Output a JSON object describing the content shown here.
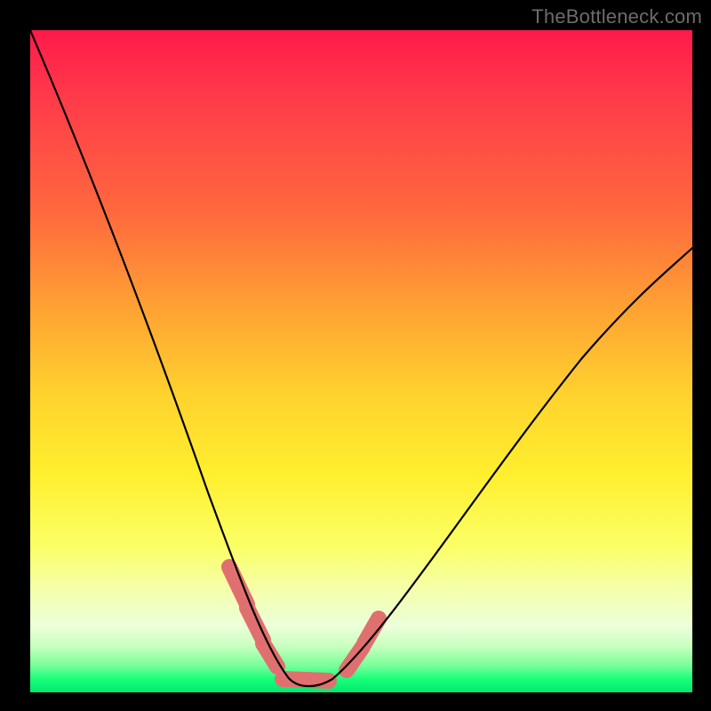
{
  "attribution": "TheBottleneck.com",
  "chart_data": {
    "type": "line",
    "title": "",
    "xlabel": "",
    "ylabel": "",
    "xlim": [
      0,
      100
    ],
    "ylim": [
      0,
      100
    ],
    "series": [
      {
        "name": "bottleneck-curve",
        "x": [
          0,
          5,
          10,
          15,
          20,
          25,
          30,
          33,
          36,
          38,
          40,
          42,
          45,
          50,
          55,
          60,
          65,
          70,
          75,
          80,
          85,
          90,
          95,
          100
        ],
        "y": [
          100,
          89,
          78,
          67,
          56,
          44,
          31,
          21,
          12,
          6,
          2,
          0,
          0,
          3,
          10,
          18,
          26,
          33,
          40,
          46,
          52,
          57,
          62,
          67
        ]
      }
    ],
    "markers": [
      {
        "name": "left-descent-markers",
        "x_range": [
          30,
          38
        ],
        "color": "#e0706f"
      },
      {
        "name": "valley-floor-markers",
        "x_range": [
          38,
          45
        ],
        "color": "#e0706f"
      },
      {
        "name": "right-ascent-markers",
        "x_range": [
          48,
          53
        ],
        "color": "#e0706f"
      }
    ],
    "background_gradient": {
      "direction": "top-to-bottom",
      "stops": [
        {
          "pos": 0,
          "color": "#ff1a4b"
        },
        {
          "pos": 50,
          "color": "#ffd22e"
        },
        {
          "pos": 90,
          "color": "#ecffda"
        },
        {
          "pos": 100,
          "color": "#00e870"
        }
      ]
    }
  }
}
